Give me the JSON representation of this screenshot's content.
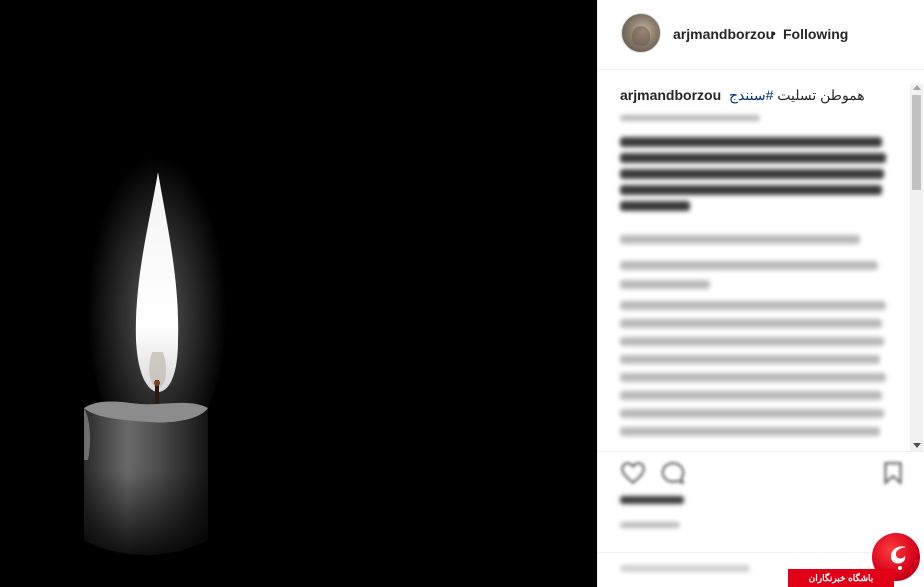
{
  "post": {
    "username": "arjmandborzou",
    "separator": "•",
    "follow_status": "Following",
    "caption": {
      "username": "arjmandborzou",
      "text": "هموطن تسلیت ",
      "hashtag": "#سنندج"
    }
  },
  "watermark": {
    "label": "باشگاه خبرنگاران"
  },
  "colors": {
    "panel_bg": "#ffffff",
    "photo_bg": "#000000",
    "text": "#262626",
    "hashtag": "#003569",
    "watermark_red": "#e10016"
  },
  "icons": {
    "like": "heart-icon",
    "comment": "speech-bubble-icon",
    "save": "bookmark-icon"
  }
}
